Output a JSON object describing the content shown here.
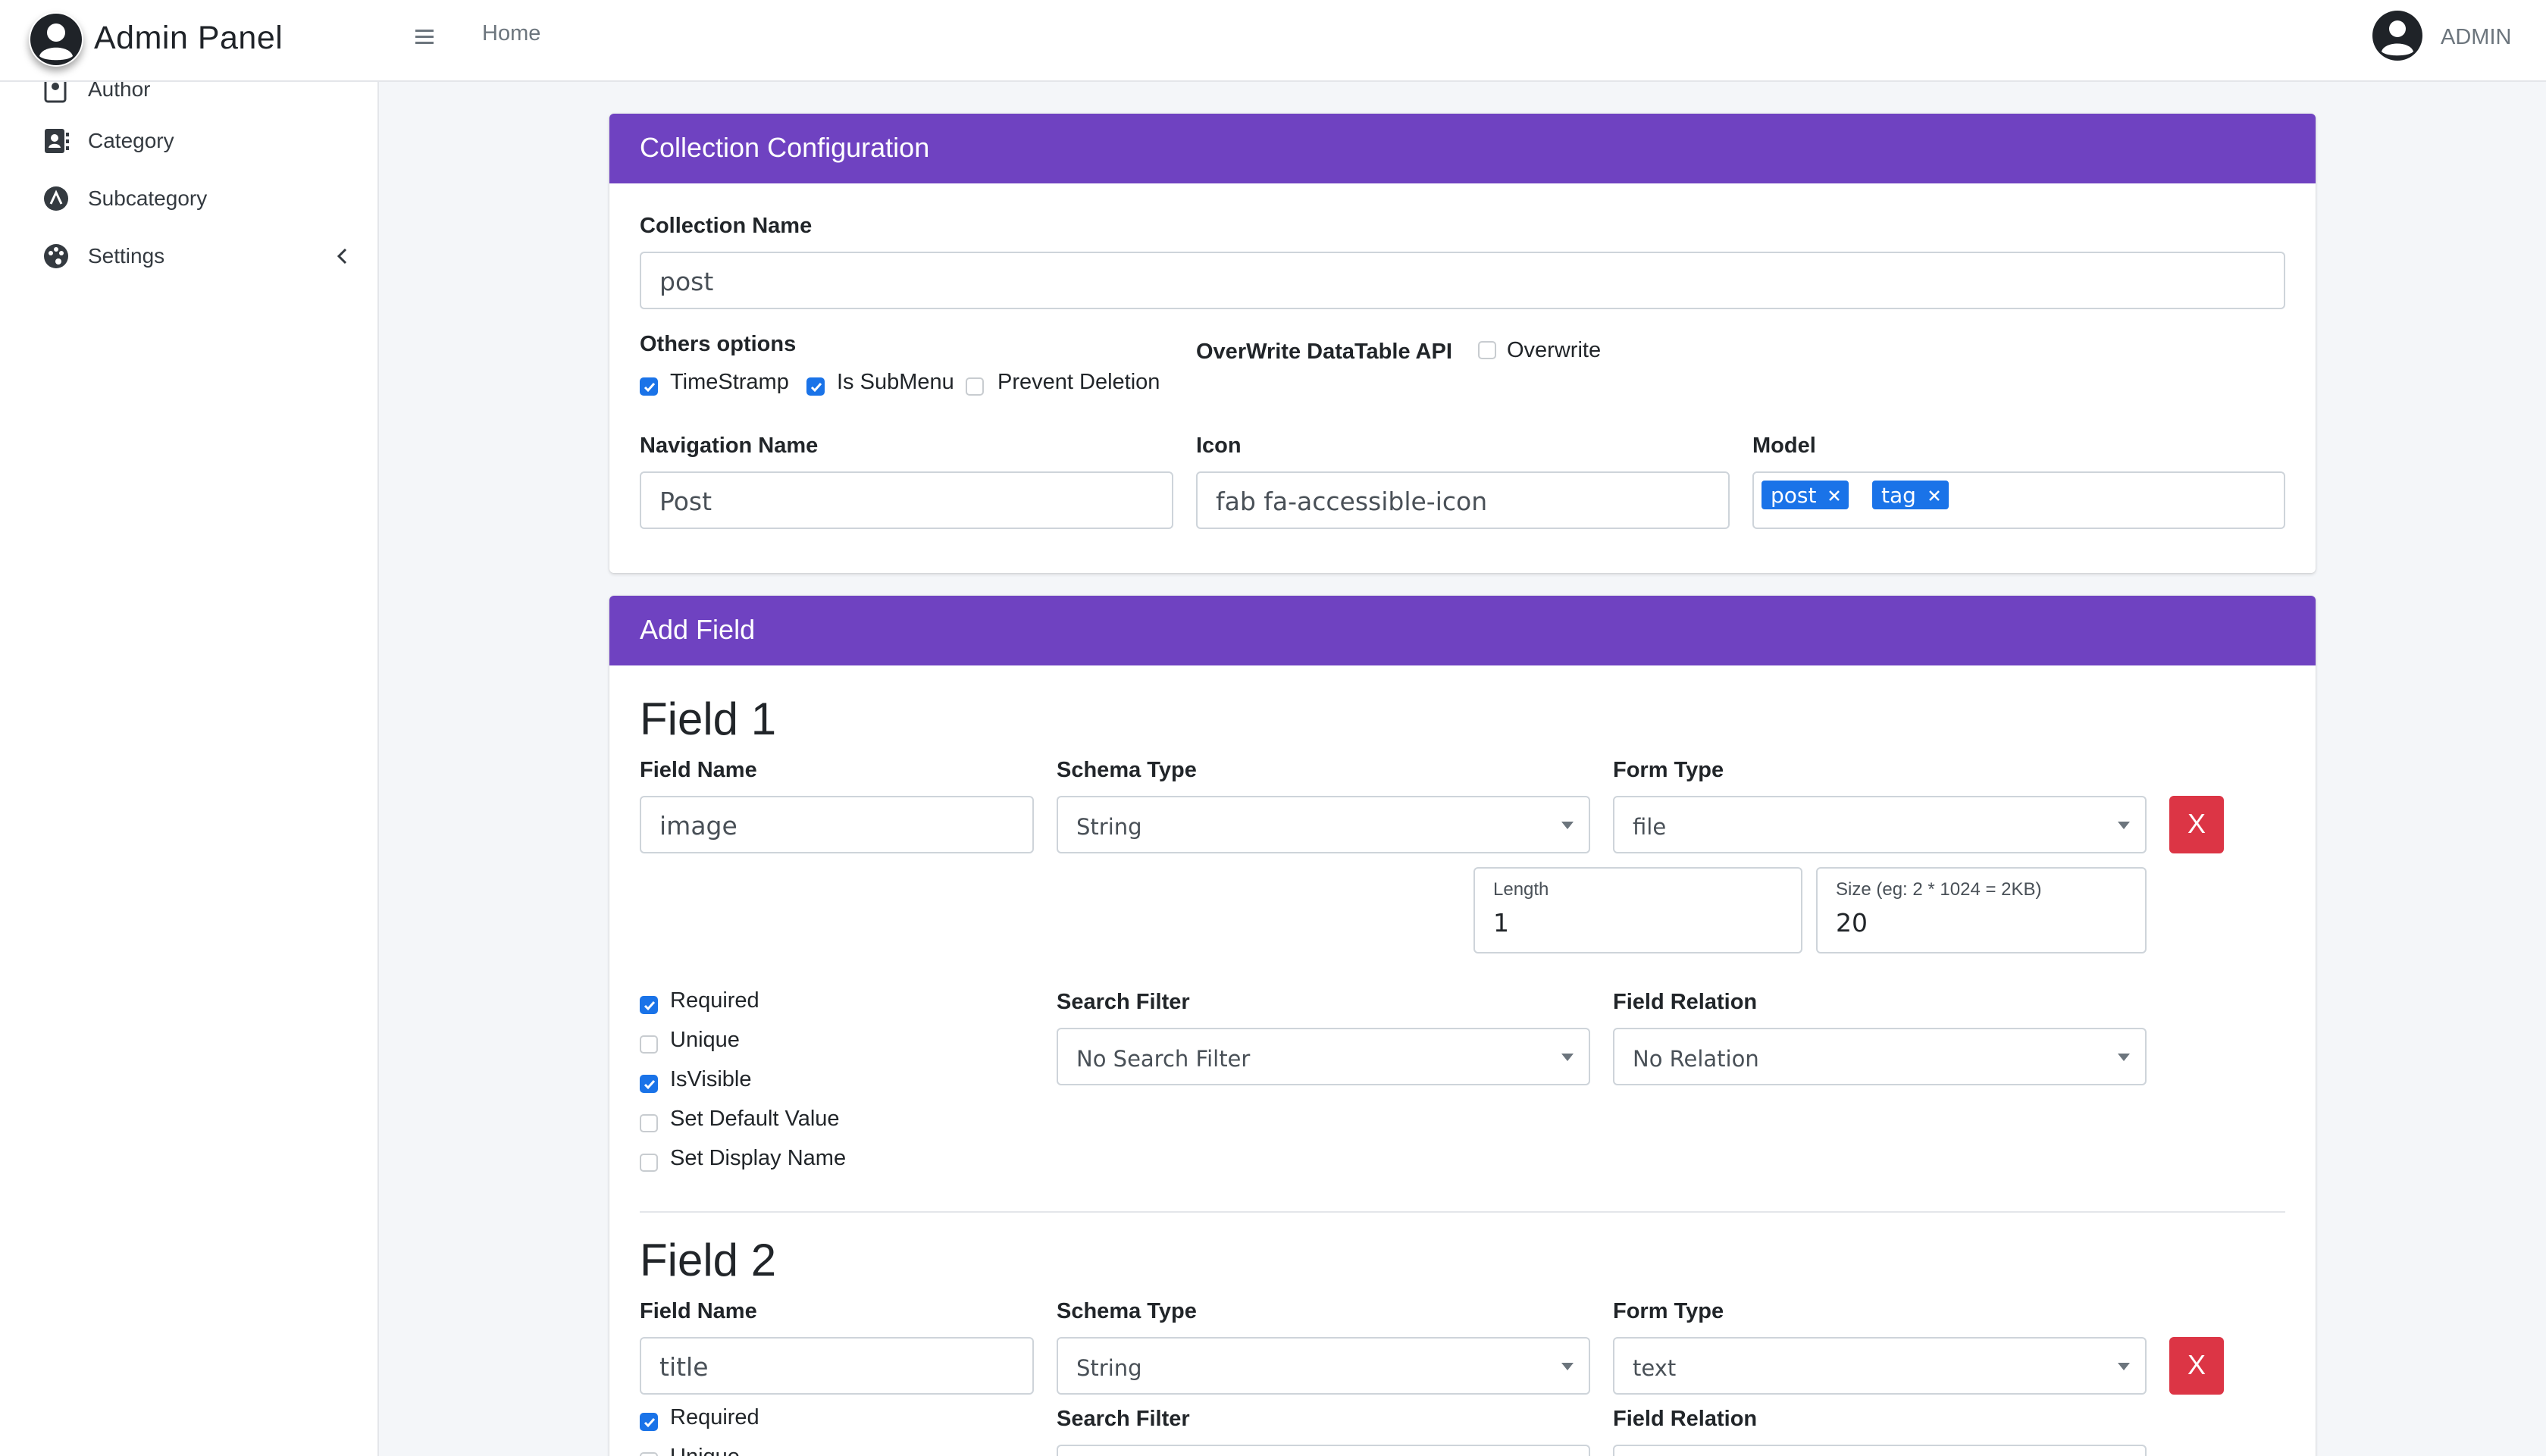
{
  "header": {
    "brand": "Admin Panel",
    "home": "Home",
    "user": "ADMIN"
  },
  "sidebar": {
    "items": [
      {
        "label": "Author",
        "icon": "author-icon"
      },
      {
        "label": "Category",
        "icon": "contact-book-icon"
      },
      {
        "label": "Subcategory",
        "icon": "circle-a-icon"
      },
      {
        "label": "Settings",
        "icon": "palette-icon"
      }
    ]
  },
  "collection": {
    "header": "Collection Configuration",
    "name_label": "Collection Name",
    "name_value": "post",
    "others_label": "Others options",
    "options": [
      {
        "label": "TimeStramp",
        "checked": true
      },
      {
        "label": "Is SubMenu",
        "checked": true
      },
      {
        "label": "Prevent Deletion",
        "checked": false
      }
    ],
    "overwrite_label": "OverWrite DataTable API",
    "overwrite_option": "Overwrite",
    "nav_label": "Navigation Name",
    "nav_value": "Post",
    "icon_label": "Icon",
    "icon_value": "fab fa-accessible-icon",
    "model_label": "Model",
    "model_tags": [
      "post",
      "tag"
    ]
  },
  "add_field": {
    "header": "Add Field",
    "fields": [
      {
        "title": "Field 1",
        "name_label": "Field Name",
        "name_value": "image",
        "schema_label": "Schema Type",
        "schema_value": "String",
        "form_label": "Form Type",
        "form_value": "file",
        "remove": "X",
        "length_label": "Length",
        "length_value": "1",
        "size_label": "Size (eg: 2 * 1024 = 2KB)",
        "size_value": "20",
        "checks": [
          {
            "label": "Required",
            "checked": true
          },
          {
            "label": "Unique",
            "checked": false
          },
          {
            "label": "IsVisible",
            "checked": true
          },
          {
            "label": "Set Default Value",
            "checked": false
          },
          {
            "label": "Set Display Name",
            "checked": false
          }
        ],
        "search_label": "Search Filter",
        "search_value": "No Search Filter",
        "relation_label": "Field Relation",
        "relation_value": "No Relation"
      },
      {
        "title": "Field 2",
        "name_label": "Field Name",
        "name_value": "title",
        "schema_label": "Schema Type",
        "schema_value": "String",
        "form_label": "Form Type",
        "form_value": "text",
        "remove": "X",
        "checks": [
          {
            "label": "Required",
            "checked": true
          },
          {
            "label": "Unique",
            "checked": false
          }
        ],
        "search_label": "Search Filter",
        "relation_label": "Field Relation"
      }
    ]
  },
  "colors": {
    "accent": "#6f42c1",
    "primary": "#1a73e8",
    "danger": "#dc3545"
  }
}
